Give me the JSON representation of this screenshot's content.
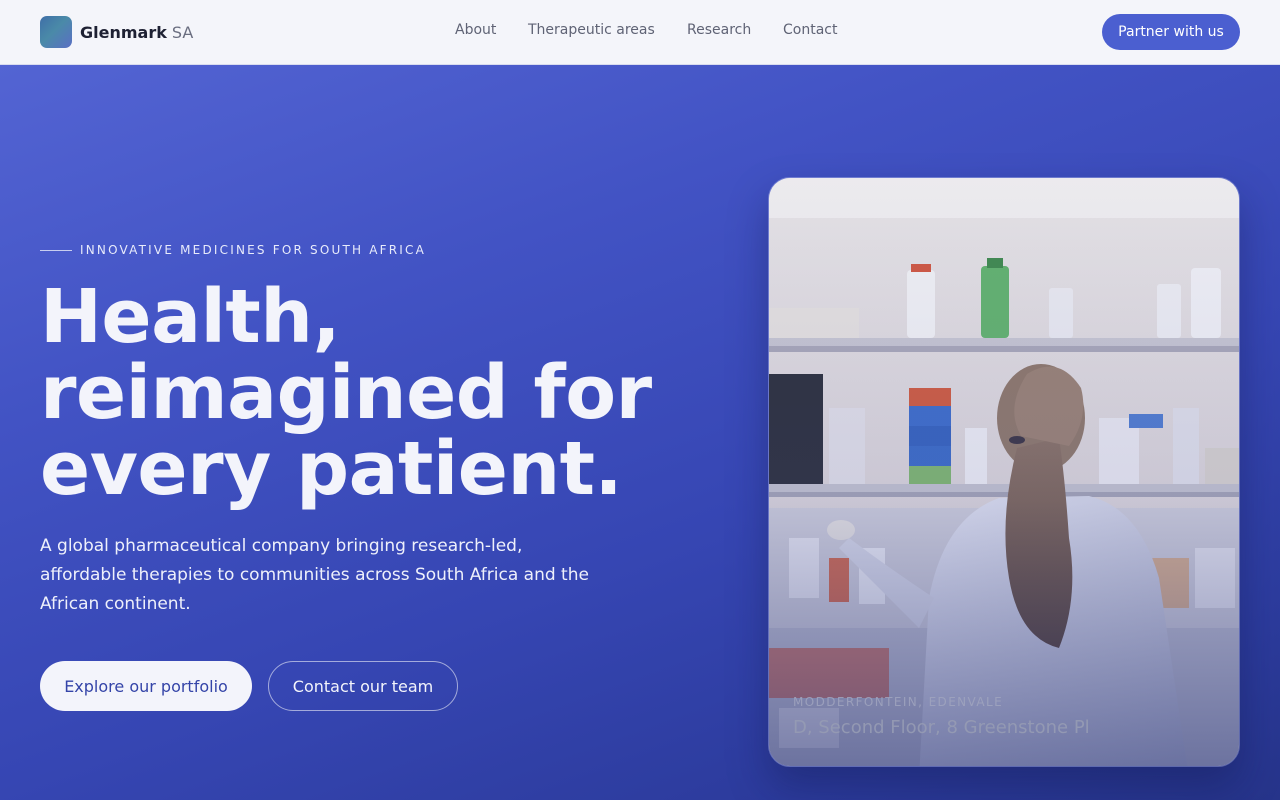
{
  "brand": {
    "name": "Glenmark",
    "suffix": "SA"
  },
  "nav": {
    "items": [
      "About",
      "Therapeutic areas",
      "Research",
      "Contact"
    ]
  },
  "header": {
    "cta_label": "Partner with us"
  },
  "hero": {
    "eyebrow": "INNOVATIVE MEDICINES FOR SOUTH AFRICA",
    "headline": [
      "Health,",
      "reimagined for",
      "every patient."
    ],
    "subcopy": "A global pharmaceutical company bringing research-led, affordable therapies to communities across South Africa and the African continent.",
    "primary_cta": "Explore our portfolio",
    "secondary_cta": "Contact our team"
  },
  "photo": {
    "alt": "Scientist in lab coat working at laboratory shelves",
    "caption_eyebrow": "MODDERFONTEIN, EDENVALE",
    "caption_address": "D, Second Floor, 8 Greenstone Pl"
  },
  "colors": {
    "accent": "#4b5fd0",
    "hero_start": "#5364d3",
    "hero_end": "#26348a",
    "header_bg": "#f4f5fa"
  }
}
